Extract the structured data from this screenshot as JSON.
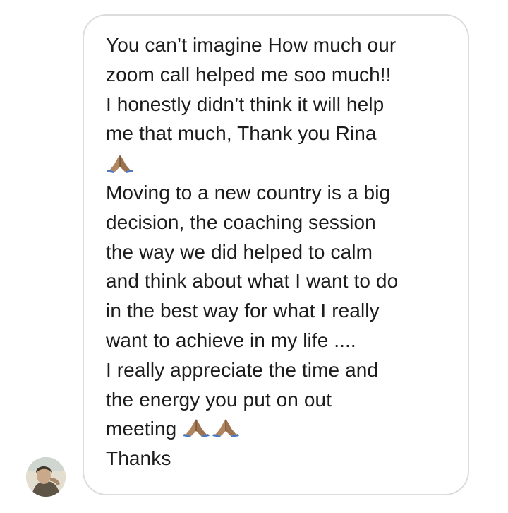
{
  "message": {
    "line1": "You can’t imagine How much  our",
    "line2": "zoom call helped me soo much!!",
    "line3": "I honestly didn’t think it will help",
    "line4": "me that much, Thank you Rina",
    "line6": "Moving to a new country is a big",
    "line7": "decision, the coaching session",
    "line8": "the way we did helped to calm",
    "line9": "and think about what I want to do",
    "line10": "in the best way for what I really",
    "line11": "want to achieve in my life ....",
    "line12": "I really appreciate the time and",
    "line13": "the energy you put on out",
    "line14": "meeting",
    "line15": "Thanks",
    "emoji": "folded-hands-medium-skin-tone"
  },
  "sender": {
    "avatar": "profile-photo"
  },
  "colors": {
    "text": "#1c1c1c",
    "bubble_border": "#dcdcdc",
    "background": "#ffffff",
    "emoji_skin": "#b08660",
    "emoji_sleeve": "#4a78c4"
  }
}
